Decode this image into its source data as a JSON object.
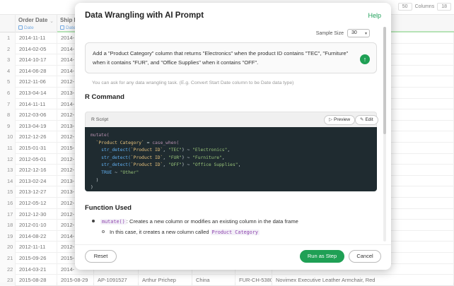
{
  "toolbar": {
    "rows_value": "50",
    "columns_label": "Columns",
    "columns_value": "18"
  },
  "grid": {
    "headers": [
      {
        "name": "",
        "type": ""
      },
      {
        "name": "Order Date",
        "type": "Date"
      },
      {
        "name": "Ship D",
        "type": "Date"
      }
    ],
    "rows": [
      {
        "n": "1",
        "cells": [
          "2014-11-11",
          "2014-",
          "",
          "",
          "",
          "",
          ""
        ]
      },
      {
        "n": "2",
        "cells": [
          "2014-02-05",
          "2014-",
          "",
          "",
          "",
          "",
          ""
        ]
      },
      {
        "n": "3",
        "cells": [
          "2014-10-17",
          "2014-",
          "",
          "",
          "",
          "",
          ""
        ]
      },
      {
        "n": "4",
        "cells": [
          "2014-06-28",
          "2014-",
          "",
          "",
          "",
          "",
          ""
        ]
      },
      {
        "n": "5",
        "cells": [
          "2012-11-06",
          "2012-",
          "",
          "",
          "",
          "",
          ""
        ]
      },
      {
        "n": "6",
        "cells": [
          "2013-04-14",
          "2013-",
          "",
          "",
          "",
          "",
          ""
        ]
      },
      {
        "n": "7",
        "cells": [
          "2014-11-11",
          "2014-",
          "",
          "",
          "",
          "",
          ""
        ]
      },
      {
        "n": "8",
        "cells": [
          "2012-03-06",
          "2012-",
          "",
          "",
          "",
          "",
          ""
        ]
      },
      {
        "n": "9",
        "cells": [
          "2013-04-19",
          "2013-",
          "",
          "",
          "",
          "",
          ""
        ]
      },
      {
        "n": "10",
        "cells": [
          "2012-12-26",
          "2012-",
          "",
          "",
          "",
          "",
          ""
        ]
      },
      {
        "n": "11",
        "cells": [
          "2015-01-31",
          "2015-",
          "",
          "",
          "",
          "",
          ""
        ]
      },
      {
        "n": "12",
        "cells": [
          "2012-05-01",
          "2012-",
          "",
          "",
          "",
          "",
          ""
        ]
      },
      {
        "n": "13",
        "cells": [
          "2012-12-16",
          "2012-",
          "",
          "",
          "",
          "",
          ""
        ]
      },
      {
        "n": "14",
        "cells": [
          "2013-02-24",
          "2013-",
          "",
          "",
          "",
          "",
          ""
        ]
      },
      {
        "n": "15",
        "cells": [
          "2013-12-27",
          "2013-",
          "",
          "",
          "",
          "",
          ""
        ]
      },
      {
        "n": "16",
        "cells": [
          "2012-05-12",
          "2012-",
          "",
          "",
          "",
          "",
          ""
        ]
      },
      {
        "n": "17",
        "cells": [
          "2012-12-30",
          "2012-",
          "",
          "",
          "",
          "",
          "Disc, 10/Pack"
        ]
      },
      {
        "n": "18",
        "cells": [
          "2012-01-10",
          "2012-",
          "",
          "",
          "",
          "",
          ""
        ]
      },
      {
        "n": "19",
        "cells": [
          "2014-08-22",
          "2014-",
          "",
          "",
          "",
          "",
          ""
        ]
      },
      {
        "n": "20",
        "cells": [
          "2012-11-11",
          "2012-",
          "",
          "",
          "",
          "",
          ""
        ]
      },
      {
        "n": "21",
        "cells": [
          "2015-09-26",
          "2015-",
          "",
          "",
          "",
          "",
          ""
        ]
      },
      {
        "n": "22",
        "cells": [
          "2014-03-21",
          "2014-",
          "",
          "",
          "",
          "",
          ""
        ]
      },
      {
        "n": "23",
        "cells": [
          "2015-08-28",
          "2015-08-29",
          "AP-1091527",
          "Arthur Prichep",
          "China",
          "FUR-CH-5380",
          "Novimex Executive Leather Armchair, Red"
        ]
      }
    ]
  },
  "modal": {
    "title": "Data Wrangling with AI Prompt",
    "help": "Help",
    "sample_size_label": "Sample Size",
    "sample_size_value": "30",
    "prompt": "Add a \"Product Category\" column that returns \"Electronics\" when the product ID contains \"TEC\", \"Furniture\" when it contains \"FUR\", and \"Office Supplies\" when it contains \"OFF\".",
    "hint": "You can ask for any data wrangling task. (E.g. Convert Start Date column to be Date data type)",
    "r_command_title": "R Command",
    "r_script_label": "R Script",
    "preview_label": "Preview",
    "edit_label": "Edit",
    "code": {
      "l1_fn": "mutate(",
      "l2_name": "`Product Category`",
      "l2_op": " = ",
      "l2_fn": "case_when(",
      "l3_fn": "str_detect(",
      "l3_col": "`Product ID`",
      "l3_sep": ", ",
      "l3_pat": "\"TEC\"",
      "l3_res": "\"Electronics\"",
      "l4_fn": "str_detect(",
      "l4_col": "`Product ID`",
      "l4_sep": ", ",
      "l4_pat": "\"FUR\"",
      "l4_res": "\"Furniture\"",
      "l5_fn": "str_detect(",
      "l5_col": "`Product ID`",
      "l5_sep": ", ",
      "l5_pat": "\"OFF\"",
      "l5_res": "\"Office Supplies\"",
      "l6_kw": "TRUE",
      "l6_res": "\"Other\"",
      "close_paren": ")",
      "tilde": ") ~ ",
      "comma": ",",
      "l6_tilde": " ~ "
    },
    "function_used_title": "Function Used",
    "fu_fn": "mutate()",
    "fu_desc": ": Creates a new column or modifies an existing column in the data frame",
    "fu_sub": "In this case, it creates a new column called ",
    "fu_sub_code": "Product Category",
    "reset_label": "Reset",
    "run_label": "Run as Step",
    "cancel_label": "Cancel"
  },
  "colors": {
    "accent": "#1fa055",
    "type_blue": "#2a7bd1",
    "code_bg": "#1f2b30"
  }
}
